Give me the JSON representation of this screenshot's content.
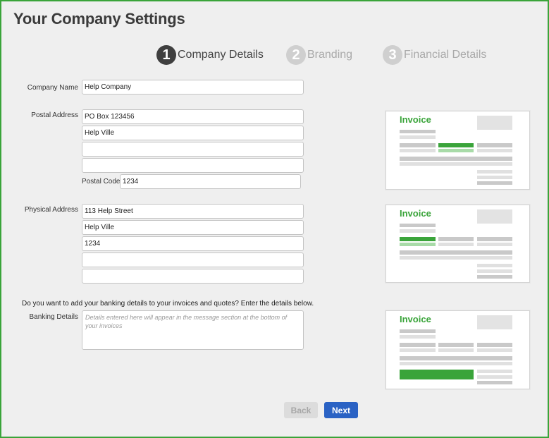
{
  "page": {
    "title": "Your Company Settings"
  },
  "steps": [
    {
      "number": "1",
      "label": "Company Details",
      "state": "active"
    },
    {
      "number": "2",
      "label": "Branding",
      "state": "inactive"
    },
    {
      "number": "3",
      "label": "Financial Details",
      "state": "inactive"
    }
  ],
  "form": {
    "company_name": {
      "label": "Company Name",
      "value": "Help Company"
    },
    "postal_address": {
      "label": "Postal Address",
      "lines": [
        "PO Box 123456",
        "Help Ville",
        "",
        ""
      ],
      "postal_code_label": "Postal Code",
      "postal_code": "1234"
    },
    "physical_address": {
      "label": "Physical Address",
      "lines": [
        "113 Help Street",
        "Help Ville",
        "1234",
        "",
        ""
      ]
    },
    "banking_question": "Do you want to add your banking details to your invoices and quotes? Enter the details below.",
    "banking_details": {
      "label": "Banking Details",
      "placeholder": "Details entered here will appear in the message section at the bottom of your invoices"
    }
  },
  "previews": [
    {
      "title": "Invoice"
    },
    {
      "title": "Invoice"
    },
    {
      "title": "Invoice"
    }
  ],
  "buttons": {
    "back": "Back",
    "next": "Next"
  },
  "colors": {
    "accent_green": "#3aa43a",
    "primary_blue": "#2a62c4",
    "border_green": "#3aa43a"
  }
}
